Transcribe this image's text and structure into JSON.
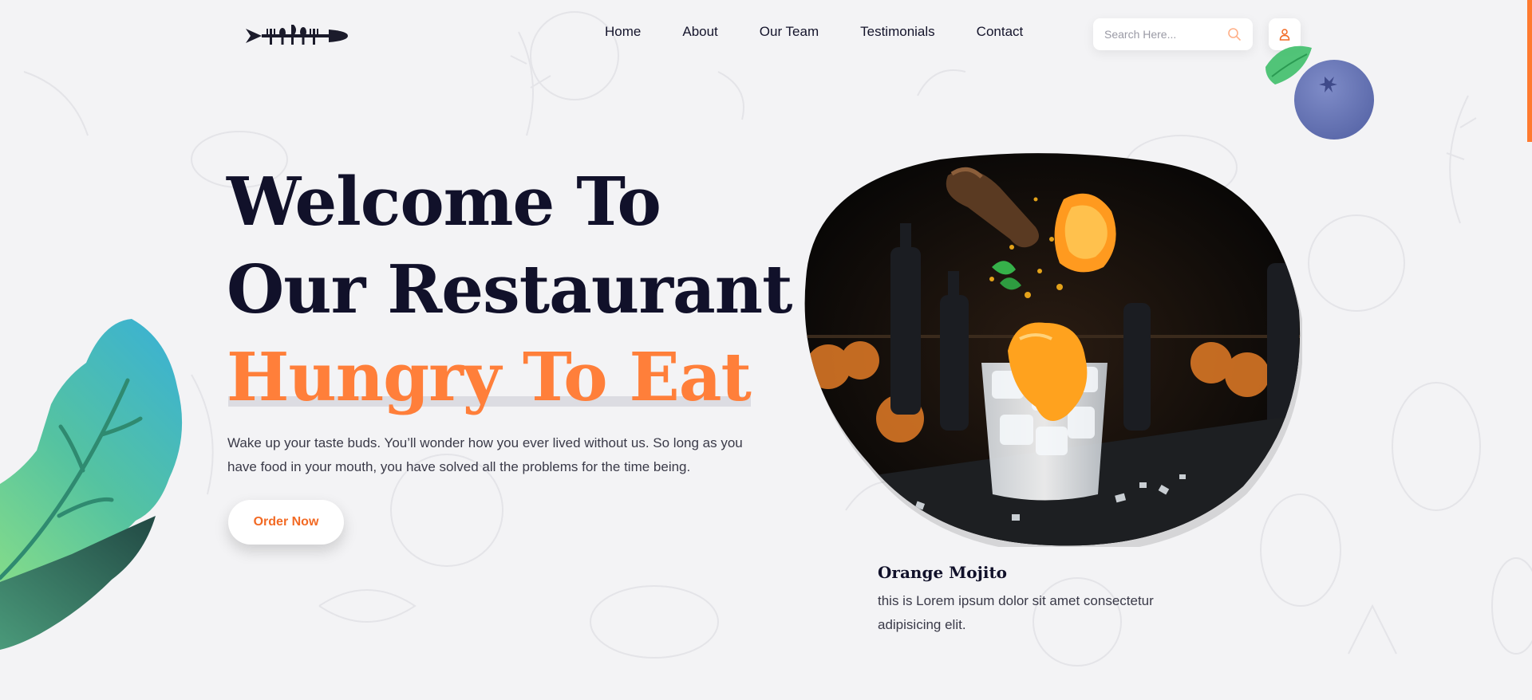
{
  "nav": {
    "items": [
      {
        "label": "Home"
      },
      {
        "label": "About"
      },
      {
        "label": "Our Team"
      },
      {
        "label": "Testimonials"
      },
      {
        "label": "Contact"
      }
    ]
  },
  "search": {
    "placeholder": "Search Here...",
    "value": ""
  },
  "hero": {
    "title_line1": "Welcome To",
    "title_line2": "Our Restaurant",
    "title_accent": "Hungry To Eat",
    "description": "Wake up your taste buds. You’ll wonder how you ever lived without us. So long as you have food in your mouth, you have solved all the problems for the time being.",
    "cta_label": "Order Now"
  },
  "featured": {
    "title": "Orange Mojito",
    "description": "this is Lorem ipsum dolor sit amet consectetur adipisicing elit."
  },
  "icons": {
    "logo": "cutlery-logo-icon",
    "search": "search-icon",
    "user": "user-icon",
    "blueberry": "blueberry-decoration-icon",
    "leaf": "leaf-decoration-icon"
  },
  "colors": {
    "accent": "#ff7f3a",
    "text_dark": "#11112a",
    "background": "#f3f3f5"
  }
}
